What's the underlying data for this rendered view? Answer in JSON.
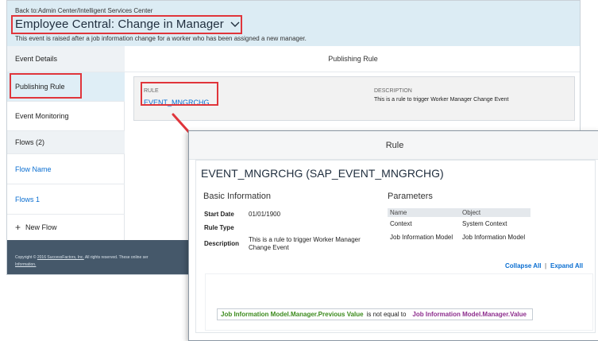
{
  "header": {
    "backlink": "Back to:Admin Center/Intelligent Services Center",
    "title": "Employee Central: Change in Manager",
    "subtitle": "This event is raised after a job information change for a worker who has been assigned a new manager."
  },
  "sidebar": {
    "items": [
      {
        "label": "Event Details"
      },
      {
        "label": "Publishing Rule"
      },
      {
        "label": "Event Monitoring"
      },
      {
        "label": "Flows (2)"
      },
      {
        "label": "Flow Name"
      },
      {
        "label": "Flows 1"
      },
      {
        "label": "New Flow"
      }
    ]
  },
  "main": {
    "section_title": "Publishing Rule",
    "rule_label": "RULE",
    "rule_value": "EVENT_MNGRCHG",
    "description_label": "DESCRIPTION",
    "description_value": "This is a rule to trigger Worker Manager Change Event"
  },
  "footer": {
    "text_prefix": "Copyright © ",
    "text_link": "2016 SuccessFactors, Inc.",
    "text_suffix": " All rights reserved. These online ser",
    "link2": "Information."
  },
  "dialog": {
    "header": "Rule",
    "title": "EVENT_MNGRCHG (SAP_EVENT_MNGRCHG)",
    "basic_info_title": "Basic Information",
    "start_date_label": "Start Date",
    "start_date_value": "01/01/1900",
    "rule_type_label": "Rule Type",
    "description_label": "Description",
    "description_value": "This is a rule to trigger Worker Manager Change Event",
    "parameters_title": "Parameters",
    "param_headers": [
      "Name",
      "Object"
    ],
    "param_rows": [
      {
        "name": "Context",
        "object": "System Context"
      },
      {
        "name": "Job Information Model",
        "object": "Job Information Model"
      }
    ],
    "collapse_all": "Collapse All",
    "separator": "|",
    "expand_all": "Expand All",
    "condition": {
      "left": "Job Information Model.Manager.Previous Value",
      "operator": "is not equal to",
      "right": "Job Information Model.Manager.Value"
    }
  },
  "colors": {
    "highlight_red": "#e0353b",
    "link_blue": "#0a6ed1",
    "header_blue": "#dcecf4",
    "footer_slate": "#45586a"
  }
}
